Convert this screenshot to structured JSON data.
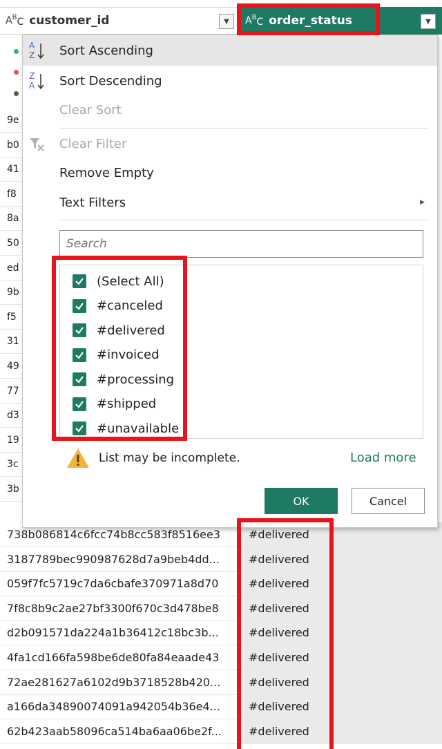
{
  "header": {
    "customer_id_label": "customer_id",
    "order_status_label": "order_status",
    "type_glyph": {
      "a": "A",
      "b": "B",
      "c": "C"
    },
    "dropdown_glyph": "▼"
  },
  "left_clip": [
    "9e",
    "b0",
    "41",
    "f8",
    "8a",
    "50",
    "ed",
    "9b",
    "f5",
    "31",
    "49",
    "77",
    "d3",
    "19",
    "3c",
    "3b"
  ],
  "menu": {
    "sort_ascending": "Sort Ascending",
    "sort_descending": "Sort Descending",
    "clear_sort": "Clear Sort",
    "clear_filter": "Clear Filter",
    "remove_empty": "Remove Empty",
    "text_filters": "Text Filters",
    "submenu_arrow": "▶",
    "search_placeholder": "Search",
    "items": [
      {
        "label": "(Select All)",
        "checked": true
      },
      {
        "label": "#canceled",
        "checked": true
      },
      {
        "label": "#delivered",
        "checked": true
      },
      {
        "label": "#invoiced",
        "checked": true
      },
      {
        "label": "#processing",
        "checked": true
      },
      {
        "label": "#shipped",
        "checked": true
      },
      {
        "label": "#unavailable",
        "checked": true
      }
    ],
    "warning": "List may be incomplete.",
    "load_more": "Load more",
    "ok": "OK",
    "cancel": "Cancel"
  },
  "rows": [
    {
      "customer_id": "738b086814c6fcc74b8cc583f8516ee3",
      "order_status": "#delivered"
    },
    {
      "customer_id": "3187789bec990987628d7a9beb4dd...",
      "order_status": "#delivered"
    },
    {
      "customer_id": "059f7fc5719c7da6cbafe370971a8d70",
      "order_status": "#delivered"
    },
    {
      "customer_id": "7f8c8b9c2ae27bf3300f670c3d478be8",
      "order_status": "#delivered"
    },
    {
      "customer_id": "d2b091571da224a1b36412c18bc3b...",
      "order_status": "#delivered"
    },
    {
      "customer_id": "4fa1cd166fa598be6de80fa84eaade43",
      "order_status": "#delivered"
    },
    {
      "customer_id": "72ae281627a6102d9b3718528b420...",
      "order_status": "#delivered"
    },
    {
      "customer_id": "a166da34890074091a942054b36e4...",
      "order_status": "#delivered"
    },
    {
      "customer_id": "62b423aab58096ca514ba6aa06be2f...",
      "order_status": "#delivered"
    }
  ],
  "colors": {
    "accent": "#1e7a62",
    "highlight": "#e8141b",
    "warning": "#f2b33d"
  }
}
